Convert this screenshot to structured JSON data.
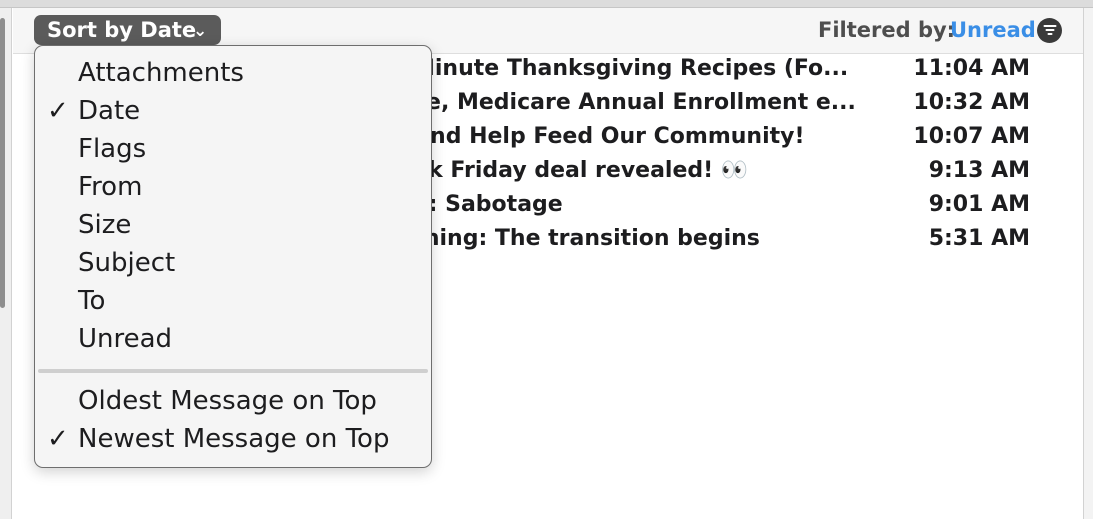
{
  "toolbar": {
    "sort_label": "Sort by Date",
    "sort_chevron": "⌄",
    "filter_label": "Filtered by:",
    "filter_value": "Unread",
    "filter_value_color": "#3a8ee6",
    "filter_icon": "filter-icon"
  },
  "messages": [
    {
      "subject": "Minute Thanksgiving Recipes (Fo...",
      "time": "11:04 AM"
    },
    {
      "subject": "ce, Medicare Annual Enrollment e...",
      "time": "10:32 AM"
    },
    {
      "subject": "And Help Feed Our Community!",
      "time": "10:07 AM"
    },
    {
      "subject": "ok Friday deal revealed! 👀",
      "time": "9:13 AM"
    },
    {
      "subject": "n: Sabotage",
      "time": "9:01 AM"
    },
    {
      "subject": "rning: The transition begins",
      "time": "5:31 AM"
    }
  ],
  "sort_menu": {
    "checkmark": "✓",
    "items": [
      {
        "label": "Attachments",
        "checked": false
      },
      {
        "label": "Date",
        "checked": true
      },
      {
        "label": "Flags",
        "checked": false
      },
      {
        "label": "From",
        "checked": false
      },
      {
        "label": "Size",
        "checked": false
      },
      {
        "label": "Subject",
        "checked": false
      },
      {
        "label": "To",
        "checked": false
      },
      {
        "label": "Unread",
        "checked": false
      }
    ],
    "order_items": [
      {
        "label": "Oldest Message on Top",
        "checked": false
      },
      {
        "label": "Newest Message on Top",
        "checked": true
      }
    ]
  }
}
